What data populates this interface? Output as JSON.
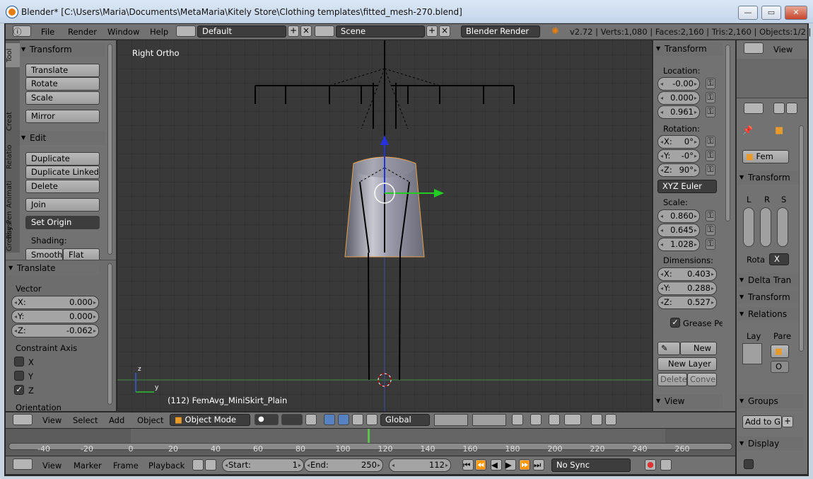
{
  "window": {
    "title": "Blender* [C:\\Users\\Maria\\Documents\\MetaMaria\\Kitely Store\\Clothing templates\\fitted_mesh-270.blend]",
    "min": "—",
    "max": "▭",
    "close": "✕"
  },
  "info_header": {
    "menus": [
      "File",
      "Render",
      "Window",
      "Help"
    ],
    "layout": "Default",
    "scene": "Scene",
    "engine": "Blender Render",
    "stats": "v2.72 | Verts:1,080 | Faces:2,160 | Tris:2,160 | Objects:1/2 | Lamp"
  },
  "tool_tabs": [
    "Tool",
    "Creat",
    "Relatio",
    "Animati",
    "Physi",
    "Grease Pen"
  ],
  "tool_shelf": {
    "transform_header": "Transform",
    "transform_buttons": [
      "Translate",
      "Rotate",
      "Scale"
    ],
    "mirror": "Mirror",
    "edit_header": "Edit",
    "edit_buttons": [
      "Duplicate",
      "Duplicate Linked",
      "Delete"
    ],
    "join": "Join",
    "set_origin": "Set Origin",
    "shading_label": "Shading:",
    "smooth": "Smooth",
    "flat": "Flat"
  },
  "operator": {
    "header": "Translate",
    "vector_label": "Vector",
    "x_key": "X:",
    "x": "0.000",
    "y_key": "Y:",
    "y": "0.000",
    "z_key": "Z:",
    "z": "-0.062",
    "constraint_label": "Constraint Axis",
    "axes": [
      "X",
      "Y",
      "Z"
    ],
    "orientation_label": "Orientation"
  },
  "viewport": {
    "view_name": "Right Ortho",
    "object_info": "(112) FemAvg_MiniSkirt_Plain",
    "axis_z": "z",
    "axis_y": "y"
  },
  "npanel": {
    "transform_header": "Transform",
    "location_label": "Location:",
    "loc": [
      "-0.00",
      "0.000",
      "0.961"
    ],
    "rotation_label": "Rotation:",
    "rot_keys": [
      "X:",
      "Y:",
      "Z:"
    ],
    "rot": [
      "0°",
      "-0°",
      "90°"
    ],
    "rot_mode": "XYZ Euler",
    "scale_label": "Scale:",
    "scale": [
      "0.860",
      "0.645",
      "1.028"
    ],
    "dimensions_label": "Dimensions:",
    "dim_keys": [
      "X:",
      "Y:",
      "Z:"
    ],
    "dim": [
      "0.403",
      "0.288",
      "0.527"
    ],
    "grease_header": "Grease Pe",
    "new": "New",
    "new_layer": "New Layer",
    "delete": "Delete",
    "convert": "Convert",
    "view_header": "View"
  },
  "props": {
    "view_label": "View",
    "object_name": "Fem",
    "transform_header": "Transform",
    "lrs": [
      "L",
      "R",
      "S"
    ],
    "rota_label": "Rota",
    "rota_value": "X",
    "delta": "Delta Tran",
    "transform2": "Transform",
    "relations": "Relations",
    "lay": "Lay",
    "pare": "Pare",
    "pare_value": "O",
    "groups": "Groups",
    "add_to_group": "Add to G",
    "display": "Display"
  },
  "viewport_header": {
    "menus": [
      "View",
      "Select",
      "Add",
      "Object"
    ],
    "mode": "Object Mode",
    "orientation": "Global"
  },
  "timeline": {
    "ticks": [
      "-40",
      "-20",
      "0",
      "20",
      "40",
      "60",
      "80",
      "100",
      "120",
      "140",
      "160",
      "180",
      "200",
      "220",
      "240",
      "260"
    ],
    "menus": [
      "View",
      "Marker",
      "Frame",
      "Playback"
    ],
    "start_label": "Start:",
    "start": "1",
    "end_label": "End:",
    "end": "250",
    "current": "112",
    "sync": "No Sync"
  }
}
